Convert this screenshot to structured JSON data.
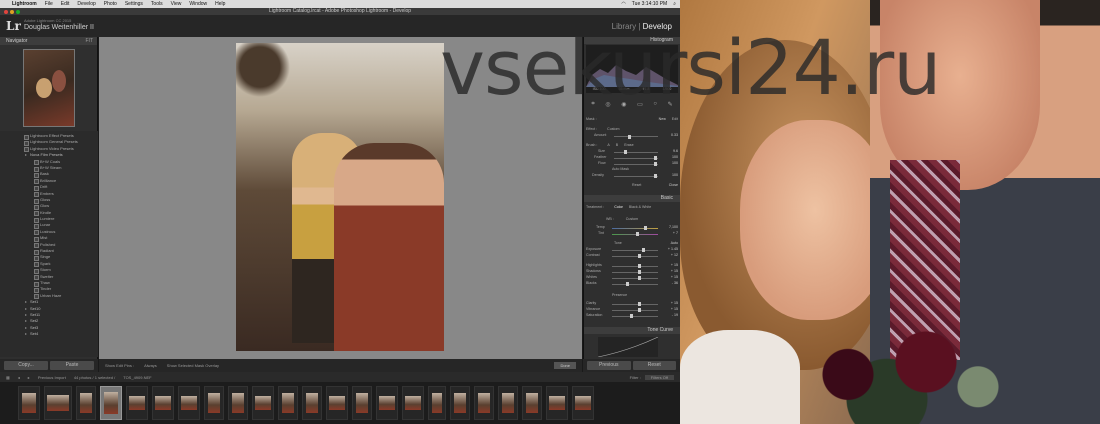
{
  "menubar": {
    "app": "Lightroom",
    "items": [
      "File",
      "Edit",
      "Develop",
      "Photo",
      "Settings",
      "Tools",
      "View",
      "Window",
      "Help"
    ],
    "clock": "Tue 3:14:10 PM"
  },
  "window": {
    "title": "Lightroom Catalog.lrcat - Adobe Photoshop Lightroom - Develop"
  },
  "header": {
    "logo": "Lr",
    "catalog_line": "Adobe Lightroom CC 2015",
    "user": "Douglas Weitenhiller II",
    "module_library": "Library",
    "module_develop": "Develop",
    "separator": "|"
  },
  "navigator": {
    "title": "Navigator",
    "zoom": "FIT"
  },
  "presets": {
    "top": [
      "Lightroom Effect Presets",
      "Lightroom General Presets",
      "Lightroom Video Presets"
    ],
    "open_group": "Nova Film Presets",
    "items": [
      "B+W Coals",
      "B+W Steam",
      "Bask",
      "Brilliance",
      "Drift",
      "Embers",
      "Gloss",
      "Glow",
      "Kindle",
      "Lumiere",
      "Lunar",
      "Lustrous",
      "Mist",
      "Polished",
      "Radiant",
      "Singe",
      "Spark",
      "Storm",
      "Swelter",
      "Thaw",
      "Tinder",
      "Urban Haze"
    ],
    "sets": [
      "Set1",
      "Set10",
      "Set11",
      "Set2",
      "Set3",
      "Set4"
    ]
  },
  "left_buttons": {
    "copy": "Copy...",
    "paste": "Paste"
  },
  "center_toolbar": {
    "show_edit_pins": "Show Edit Pins :",
    "always": "Always",
    "show_overlay": "Show Selected Mask Overlay",
    "done": "Done"
  },
  "right": {
    "histogram": "Histogram",
    "histo_readout": [
      "ISO 100",
      "35 mm",
      "f/1.8",
      "1/500"
    ],
    "mask": "Mask :",
    "new": "New",
    "edit": "Edit",
    "effect": "Effect :",
    "custom": "Custom",
    "amount": "Amount",
    "amount_v": "0.33",
    "brush": "Brush :",
    "brush_a": "A",
    "brush_b": "B",
    "erase": "Erase",
    "size": "Size",
    "size_v": "9.6",
    "feather": "Feather",
    "feather_v": "100",
    "flow": "Flow",
    "flow_v": "100",
    "auto_mask": "Auto Mask",
    "density": "Density",
    "density_v": "100",
    "reset": "Reset",
    "close": "Close",
    "basic": "Basic",
    "treatment": "Treatment :",
    "color": "Color",
    "bw": "Black & White",
    "wb": "WB :",
    "wb_v": "Custom",
    "temp": "Temp",
    "temp_v": "7,100",
    "tint": "Tint",
    "tint_v": "+ 7",
    "tone": "Tone",
    "auto": "Auto",
    "exposure": "Exposure",
    "exposure_v": "+ 1.45",
    "contrast": "Contrast",
    "contrast_v": "+ 12",
    "highlights": "Highlights",
    "highlights_v": "+ 15",
    "shadows": "Shadows",
    "shadows_v": "+ 15",
    "whites": "Whites",
    "whites_v": "+ 15",
    "blacks": "Blacks",
    "blacks_v": "- 36",
    "presence": "Presence",
    "clarity": "Clarity",
    "clarity_v": "+ 15",
    "vibrance": "Vibrance",
    "vibrance_v": "+ 15",
    "saturation": "Saturation",
    "saturation_v": "- 19",
    "tone_curve": "Tone Curve",
    "previous": "Previous",
    "reset_btn": "Reset"
  },
  "filmstrip_bar": {
    "previous_import": "Previous Import",
    "count": "44 photos / 1 selected /",
    "file": "TOS_4909.NEF",
    "filter_label": "Filter :",
    "filter_value": "Filters Off"
  },
  "watermark": "vsekursi24.ru"
}
